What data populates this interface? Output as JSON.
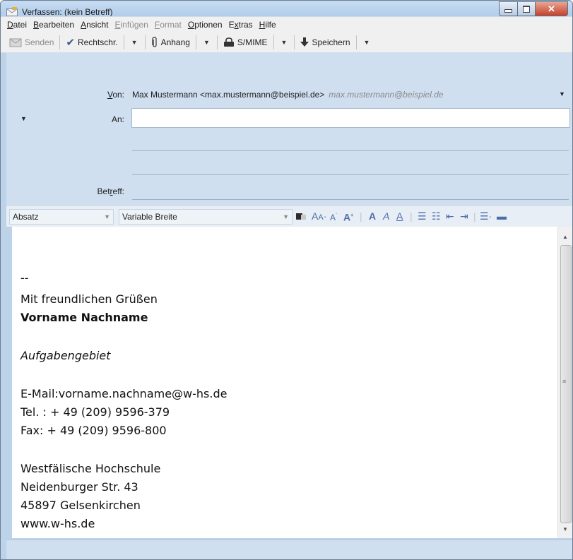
{
  "window": {
    "title": "Verfassen: (kein Betreff)",
    "icon": "compose-envelope-icon",
    "controls": [
      "minimize-icon",
      "maximize-icon",
      "close-icon"
    ]
  },
  "menubar": [
    {
      "label": "Datei",
      "accel": "D",
      "rest": "atei",
      "disabled": false
    },
    {
      "label": "Bearbeiten",
      "accel": "B",
      "rest": "earbeiten",
      "disabled": false
    },
    {
      "label": "Ansicht",
      "accel": "A",
      "rest": "nsicht",
      "disabled": false
    },
    {
      "label": "Einfügen",
      "accel": "E",
      "rest": "infügen",
      "disabled": true
    },
    {
      "label": "Format",
      "accel": "F",
      "rest": "ormat",
      "disabled": true
    },
    {
      "label": "Optionen",
      "accel": "O",
      "rest": "ptionen",
      "disabled": false
    },
    {
      "label": "Extras",
      "pre": "E",
      "accel": "x",
      "rest": "tras",
      "disabled": false
    },
    {
      "label": "Hilfe",
      "accel": "H",
      "rest": "ilfe",
      "disabled": false
    }
  ],
  "toolbar": {
    "send_label": "Senden",
    "spell_label": "Rechtschr.",
    "attach_label": "Anhang",
    "smime_label": "S/MIME",
    "save_label": "Speichern",
    "dropdown_glyph": "▼"
  },
  "header": {
    "from_label_accel": "V",
    "from_label_rest": "on:",
    "from_value": "Max Mustermann <max.mustermann@beispiel.de>",
    "from_hint": "max.mustermann@beispiel.de",
    "to_label": "An:",
    "to_value": "",
    "subject_label_pre": "Bet",
    "subject_label_accel": "r",
    "subject_label_rest": "eff:",
    "subject_value": ""
  },
  "formatbar": {
    "paragraph_style": "Absatz",
    "font": "Variable Breite"
  },
  "body": {
    "sig_separator": "--",
    "greeting": "Mit freundlichen Grüßen",
    "name": "Vorname Nachname",
    "department": "Aufgabengebiet",
    "email": "E-Mail:vorname.nachname@w-hs.de",
    "phone": "Tel. : + 49 (209) 9596-379",
    "fax": "Fax: + 49 (209) 9596-800",
    "org": "Westfälische Hochschule",
    "street": "Neidenburger Str. 43",
    "city": "45897 Gelsenkirchen",
    "web": "www.w-hs.de"
  }
}
